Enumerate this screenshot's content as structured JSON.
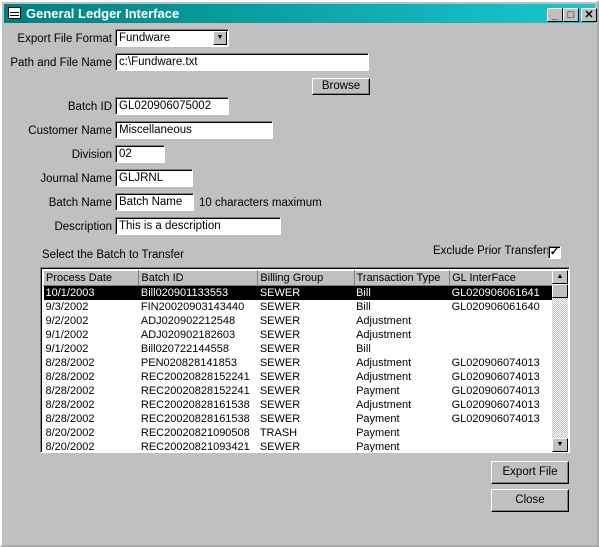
{
  "window": {
    "title": "General Ledger Interface",
    "min": "_",
    "max": "□",
    "close": "✕"
  },
  "form": {
    "export_format": {
      "label": "Export File Format",
      "value": "Fundware"
    },
    "path": {
      "label": "Path and File Name",
      "value": "c:\\Fundware.txt"
    },
    "browse": "Browse",
    "batch_id": {
      "label": "Batch ID",
      "value": "GL020906075002"
    },
    "customer": {
      "label": "Customer Name",
      "value": "Miscellaneous"
    },
    "division": {
      "label": "Division",
      "value": "02"
    },
    "journal": {
      "label": "Journal Name",
      "value": "GLJRNL"
    },
    "batch_name": {
      "label": "Batch Name",
      "value": "Batch Name",
      "hint": "10 characters maximum"
    },
    "description": {
      "label": "Description",
      "value": "This is a description"
    }
  },
  "list": {
    "label": "Select the Batch to Transfer",
    "exclude_label": "Exclude Prior Transfers",
    "exclude_checked": true,
    "columns": [
      "Process Date",
      "Batch ID",
      "Billing Group",
      "Transaction Type",
      "GL InterFace"
    ],
    "rows": [
      [
        "10/1/2003",
        "Bill020901133553",
        "SEWER",
        "Bill",
        "GL020906061641"
      ],
      [
        "9/3/2002",
        "FIN20020903143440",
        "SEWER",
        "Bill",
        "GL020906061640"
      ],
      [
        "9/2/2002",
        "ADJ020902212548",
        "SEWER",
        "Adjustment",
        ""
      ],
      [
        "9/1/2002",
        "ADJ020902182603",
        "SEWER",
        "Adjustment",
        ""
      ],
      [
        "9/1/2002",
        "Bill020722144558",
        "SEWER",
        "Bill",
        ""
      ],
      [
        "8/28/2002",
        "PEN020828141853",
        "SEWER",
        "Adjustment",
        "GL020906074013"
      ],
      [
        "8/28/2002",
        "REC20020828152241",
        "SEWER",
        "Adjustment",
        "GL020906074013"
      ],
      [
        "8/28/2002",
        "REC20020828152241",
        "SEWER",
        "Payment",
        "GL020906074013"
      ],
      [
        "8/28/2002",
        "REC20020828161538",
        "SEWER",
        "Adjustment",
        "GL020906074013"
      ],
      [
        "8/28/2002",
        "REC20020828161538",
        "SEWER",
        "Payment",
        "GL020906074013"
      ],
      [
        "8/20/2002",
        "REC20020821090508",
        "TRASH",
        "Payment",
        ""
      ],
      [
        "8/20/2002",
        "REC20020821093421",
        "SEWER",
        "Payment",
        ""
      ]
    ],
    "selected_row": 0
  },
  "buttons": {
    "export": "Export File",
    "close": "Close"
  }
}
